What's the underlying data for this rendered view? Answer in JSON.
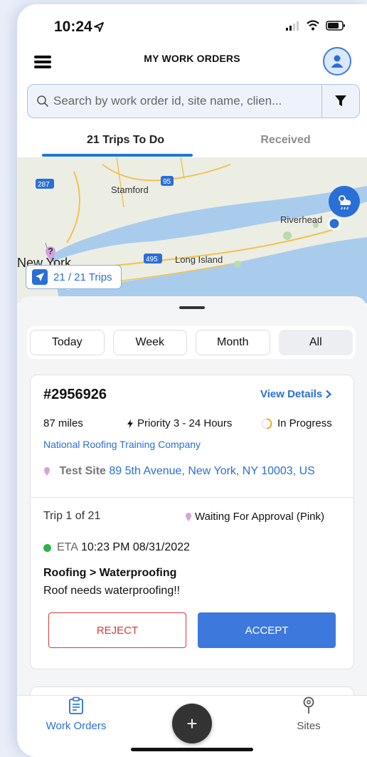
{
  "status_bar": {
    "time": "10:24"
  },
  "header": {
    "title": "MY WORK ORDERS"
  },
  "search": {
    "placeholder": "Search by work order id, site name, clien..."
  },
  "tabs": [
    {
      "label": "21 Trips To Do",
      "active": true
    },
    {
      "label": "Received",
      "active": false
    }
  ],
  "map": {
    "labels": {
      "stamford": "Stamford",
      "riverhead": "Riverhead",
      "new_york": "New York",
      "long_island": "Long Island"
    },
    "shields": {
      "i287": "287",
      "i95": "95",
      "i495": "495"
    },
    "pin_marker": "?",
    "trips_chip": "21 / 21 Trips"
  },
  "filters": [
    {
      "label": "Today",
      "active": false
    },
    {
      "label": "Week",
      "active": false
    },
    {
      "label": "Month",
      "active": false
    },
    {
      "label": "All",
      "active": true
    }
  ],
  "work_order": {
    "id": "#2956926",
    "view_details": "View Details",
    "distance": "87 miles",
    "priority": "Priority 3 - 24 Hours",
    "status": "In Progress",
    "company": "National Roofing Training Company",
    "site_name": "Test Site",
    "site_address": "89 5th Avenue, New York, NY 10003, US",
    "trip": "Trip 1 of 21",
    "approval_status": "Waiting For Approval (Pink)",
    "eta_label": "ETA",
    "eta_value": "10:23 PM 08/31/2022",
    "category": "Roofing > Waterproofing",
    "description": "Roof needs waterproofing!!",
    "reject_label": "REJECT",
    "accept_label": "ACCEPT"
  },
  "bottom_nav": {
    "work_orders": "Work Orders",
    "add": "+",
    "sites": "Sites"
  },
  "colors": {
    "accent": "#2a6fd6",
    "reject": "#d93a3a",
    "accept": "#3d79dc",
    "eta_dot": "#2bb24c",
    "status_ring": "#f0a500",
    "pin": "#d6a3d8"
  },
  "icons": {
    "menu": "hamburger-icon",
    "profile": "user-icon",
    "search": "search-icon",
    "filter": "filter-icon",
    "weather": "weather-icon",
    "navigate": "navigation-arrow-icon",
    "chevron": "chevron-right-icon",
    "priority": "lightning-icon",
    "progress": "progress-ring-icon",
    "pin": "map-pin-icon",
    "work_orders": "clipboard-icon",
    "sites": "location-pin-icon"
  }
}
